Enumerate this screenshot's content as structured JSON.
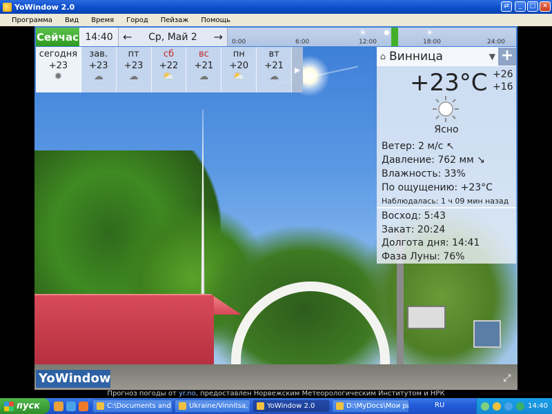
{
  "window": {
    "title": "YoWindow 2.0"
  },
  "menu": [
    "Программа",
    "Вид",
    "Время",
    "Город",
    "Пейзаж",
    "Помощь"
  ],
  "topbar": {
    "now_label": "Сейчас",
    "time": "14:40",
    "date": "Ср, Май 2",
    "prev_arrow": "←",
    "next_arrow": "→",
    "ticks": [
      "0:00",
      "6:00",
      "12:00",
      "18:00",
      "24:00"
    ]
  },
  "days": [
    {
      "name": "сегодня",
      "temp": "+23",
      "icon": "sun-icon",
      "weekend": false
    },
    {
      "name": "зав.",
      "temp": "+23",
      "icon": "rain-icon",
      "weekend": false
    },
    {
      "name": "пт",
      "temp": "+23",
      "icon": "rain-icon",
      "weekend": false
    },
    {
      "name": "сб",
      "temp": "+22",
      "icon": "partly-cloudy-icon",
      "weekend": true
    },
    {
      "name": "вс",
      "temp": "+21",
      "icon": "rain-icon",
      "weekend": true
    },
    {
      "name": "пн",
      "temp": "+20",
      "icon": "partly-cloudy-icon",
      "weekend": false
    },
    {
      "name": "вт",
      "temp": "+21",
      "icon": "rain-icon",
      "weekend": false
    }
  ],
  "panel": {
    "city": "Винница",
    "temp": "+23°C",
    "high": "+26",
    "low": "+16",
    "condition": "Ясно",
    "wind": "Ветер:  2 м/с",
    "pressure": "Давление:  762 мм",
    "humidity": "Влажность:  33%",
    "feels": "По ощущению:  +23°C",
    "observed": "Наблюдалась:  1 ч 09 мин назад",
    "sunrise": "Восход:  5:43",
    "sunset": "Закат:  20:24",
    "daylength": "Долгота дня:  14:41",
    "moon": "Фаза Луны:  76%"
  },
  "logo": "YoWindow",
  "credit": {
    "prefix": "Прогноз погоды от",
    "link": "yr.no",
    "suffix": ", предоставлен Норвежским Метеорологическим Институтом и НРК"
  },
  "taskbar": {
    "start": "пуск",
    "tasks": [
      "C:\\Documents and...",
      "Ukraine/Vinnitsa, ...",
      "YoWindow 2.0",
      "D:\\MyDocs\\Мои ри..."
    ],
    "lang": "RU",
    "clock": "14:40"
  }
}
